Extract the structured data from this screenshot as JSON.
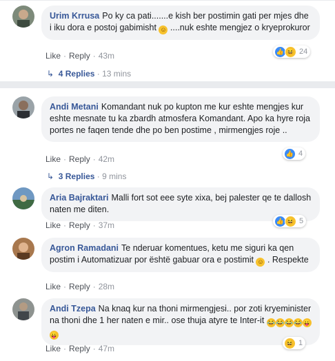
{
  "comments": [
    {
      "author": "Urim Krrusa",
      "text": "Po ky ca pati.......e kish ber postimin gati per mjes dhe i iku dora e postoj gabimisht",
      "text_after": " ....nuk eshte mengjez o kryeprokuror",
      "like": "Like",
      "reply": "Reply",
      "time": "43m",
      "reaction_count": "24",
      "replies": "4 Replies",
      "replies_time": "13 mins"
    },
    {
      "author": "Andi Metani",
      "text": "Komandant nuk po kupton me kur eshte mengjes kur eshte mesnate tu ka zbardh atmosfera Komandant. Apo ka hyre roja portes ne faqen tende dhe po ben postime , mirmengjes roje ..",
      "like": "Like",
      "reply": "Reply",
      "time": "42m",
      "reaction_count": "4",
      "replies": "3 Replies",
      "replies_time": "9 mins"
    },
    {
      "author": "Aria Bajraktari",
      "text": "Malli fort sot eee syte xixa, bej palester qe te dallosh naten me diten.",
      "like": "Like",
      "reply": "Reply",
      "time": "37m",
      "reaction_count": "5"
    },
    {
      "author": "Agron Ramadani",
      "text": "Te nderuar komentues, ketu me siguri ka qen postim i Automatizuar por është gabuar ora e postimit",
      "text_after": " . Respekte",
      "like": "Like",
      "reply": "Reply",
      "time": "28m"
    },
    {
      "author": "Andi Tzepa",
      "text": "Na knaq kur na thoni mirmengjesi.. por zoti kryeminister na thoni dhe 1 her naten e mir.. ose thuja atyre te Inter-it",
      "like": "Like",
      "reply": "Reply",
      "time": "47m",
      "reaction_count": "1"
    }
  ],
  "colors": {
    "link": "#385898",
    "bubble": "#f2f3f5",
    "meta": "#90949c"
  }
}
